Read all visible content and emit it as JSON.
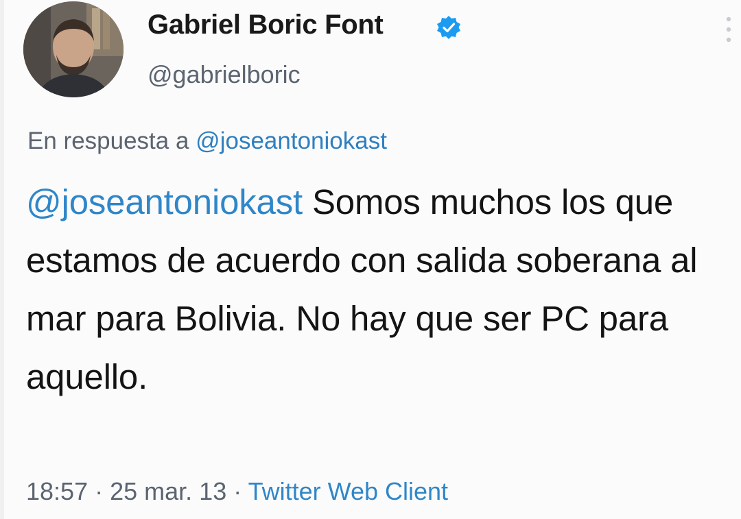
{
  "user": {
    "display_name": "Gabriel Boric Font",
    "handle": "@gabrielboric",
    "verified": true,
    "verified_color": "#1d9bf0"
  },
  "reply": {
    "prefix": "En respuesta a",
    "mention": "@joseantoniokast"
  },
  "tweet": {
    "mention": "@joseantoniokast",
    "text": "Somos muchos los que estamos de acuerdo con salida soberana al mar para Bolivia. No hay que ser PC para aquello."
  },
  "meta": {
    "time": "18:57",
    "separator": "·",
    "date": "25 mar. 13",
    "source": "Twitter Web Client"
  },
  "icons": {
    "avatar": "profile-photo",
    "verified": "verified-badge-icon",
    "more": "vertical-more-icon"
  },
  "colors": {
    "link": "#2f86c8",
    "secondary_text": "#5b6470",
    "primary_text": "#141414"
  }
}
